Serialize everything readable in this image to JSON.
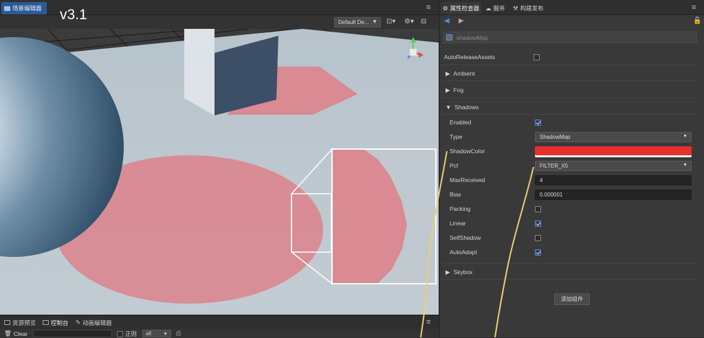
{
  "version_label": "v3.1",
  "scene_panel": {
    "tab_label": "场景编辑器",
    "camera_dropdown": "Default De...",
    "icons": [
      "camera-icon",
      "gear-icon",
      "save-icon"
    ]
  },
  "bottom_panel": {
    "tabs": [
      {
        "label": "资源预览",
        "icon": "folder-icon"
      },
      {
        "label": "控制台",
        "icon": "console-icon"
      },
      {
        "label": "动画编辑器",
        "icon": "animation-icon"
      }
    ],
    "clear_label": "Clear",
    "regex_label": "正则",
    "level_value": "all"
  },
  "inspector": {
    "tabs": [
      {
        "label": "属性检查器",
        "icon": "gear-icon"
      },
      {
        "label": "服务",
        "icon": "cloud-icon"
      },
      {
        "label": "构建发布",
        "icon": "hammer-icon"
      }
    ],
    "component_name": "shadowMap",
    "auto_release_label": "AutoReleaseAssets",
    "sections": {
      "ambient": "Ambient",
      "fog": "Fog",
      "shadows": "Shadows",
      "skybox": "Skybox"
    },
    "shadow_props": {
      "enabled_label": "Enabled",
      "type_label": "Type",
      "type_value": "ShadowMap",
      "shadow_color_label": "ShadowColor",
      "shadow_color": "#e6302b",
      "pcf_label": "Pcf",
      "pcf_value": "FILTER_X5",
      "max_received_label": "MaxReceived",
      "max_received_value": "4",
      "bias_label": "Bias",
      "bias_value": "0.000001",
      "packing_label": "Packing",
      "linear_label": "Linear",
      "self_shadow_label": "SelfShadow",
      "auto_adapt_label": "AutoAdapt"
    },
    "checkboxes": {
      "auto_release": false,
      "enabled": true,
      "packing": false,
      "linear": true,
      "self_shadow": false,
      "auto_adapt": true
    },
    "add_component_label": "添加组件"
  },
  "colors": {
    "accent_tab": "#2d5a94",
    "shadow_pink": "#d98a92",
    "callout_yellow": "#e9cf73"
  }
}
